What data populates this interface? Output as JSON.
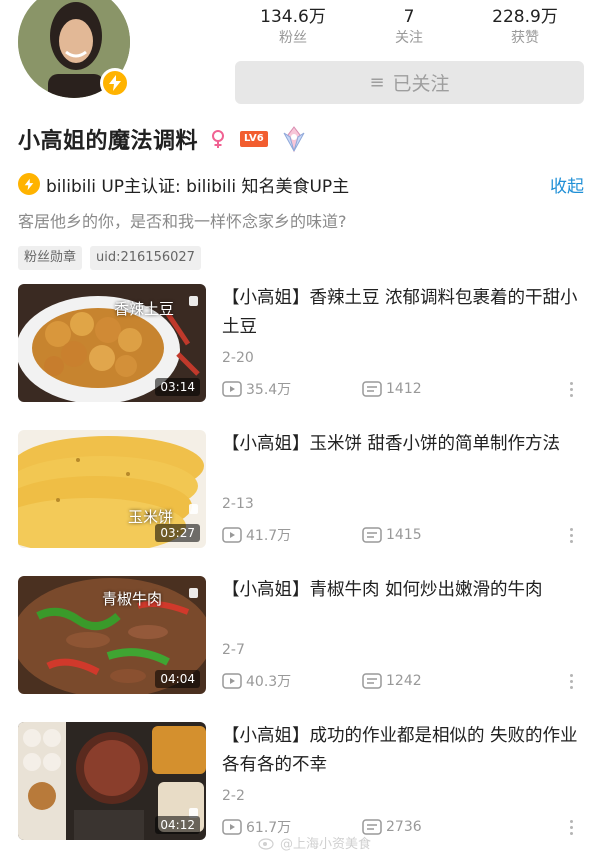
{
  "profile": {
    "name": "小高姐的魔法调料",
    "level": "LV6",
    "stats": [
      {
        "value": "134.6万",
        "label": "粉丝"
      },
      {
        "value": "7",
        "label": "关注"
      },
      {
        "value": "228.9万",
        "label": "获赞"
      }
    ],
    "follow_label": "已关注",
    "certification": "bilibili  UP主认证: bilibili  知名美食UP主",
    "collapse_label": "收起",
    "bio": "客居他乡的你，是否和我一样怀念家乡的味道?",
    "tags": [
      "粉丝勋章",
      "uid:216156027"
    ]
  },
  "videos": [
    {
      "title": "【小高姐】香辣土豆  浓郁调料包裹着的干甜小土豆",
      "thumb_text": "香辣土豆",
      "duration": "03:14",
      "date": "2-20",
      "plays": "35.4万",
      "danmaku": "1412"
    },
    {
      "title": "【小高姐】玉米饼  甜香小饼的简单制作方法",
      "thumb_text": "玉米饼",
      "duration": "03:27",
      "date": "2-13",
      "plays": "41.7万",
      "danmaku": "1415"
    },
    {
      "title": "【小高姐】青椒牛肉    如何炒出嫩滑的牛肉",
      "thumb_text": "青椒牛肉",
      "duration": "04:04",
      "date": "2-7",
      "plays": "40.3万",
      "danmaku": "1242"
    },
    {
      "title": "【小高姐】成功的作业都是相似的  失败的作业各有各的不幸",
      "thumb_text": "",
      "duration": "04:12",
      "date": "2-2",
      "plays": "61.7万",
      "danmaku": "2736"
    }
  ],
  "watermark": "@上海小资美食",
  "colors": {
    "accent_blue": "#1f8fd6",
    "level_orange": "#f25d2f",
    "badge_yellow": "#ffb300"
  }
}
